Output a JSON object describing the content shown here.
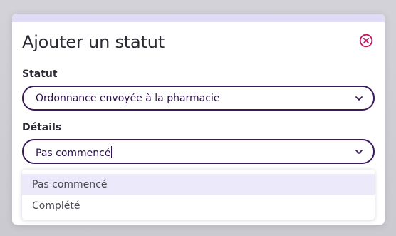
{
  "modal": {
    "title": "Ajouter un statut"
  },
  "status_field": {
    "label": "Statut",
    "value": "Ordonnance envoyée à la pharmacie"
  },
  "details_field": {
    "label": "Détails",
    "value": "Pas commencé"
  },
  "details_dropdown": {
    "options": [
      {
        "label": "Pas commencé",
        "highlighted": true
      },
      {
        "label": "Complété",
        "highlighted": false
      }
    ]
  },
  "colors": {
    "accent": "#3b1a5c",
    "close_icon": "#c2185b",
    "highlight": "#ece9fb",
    "topbar": "#e0dcf5"
  },
  "icons": {
    "close": "close-circle-icon",
    "chevron": "chevron-down-icon"
  }
}
